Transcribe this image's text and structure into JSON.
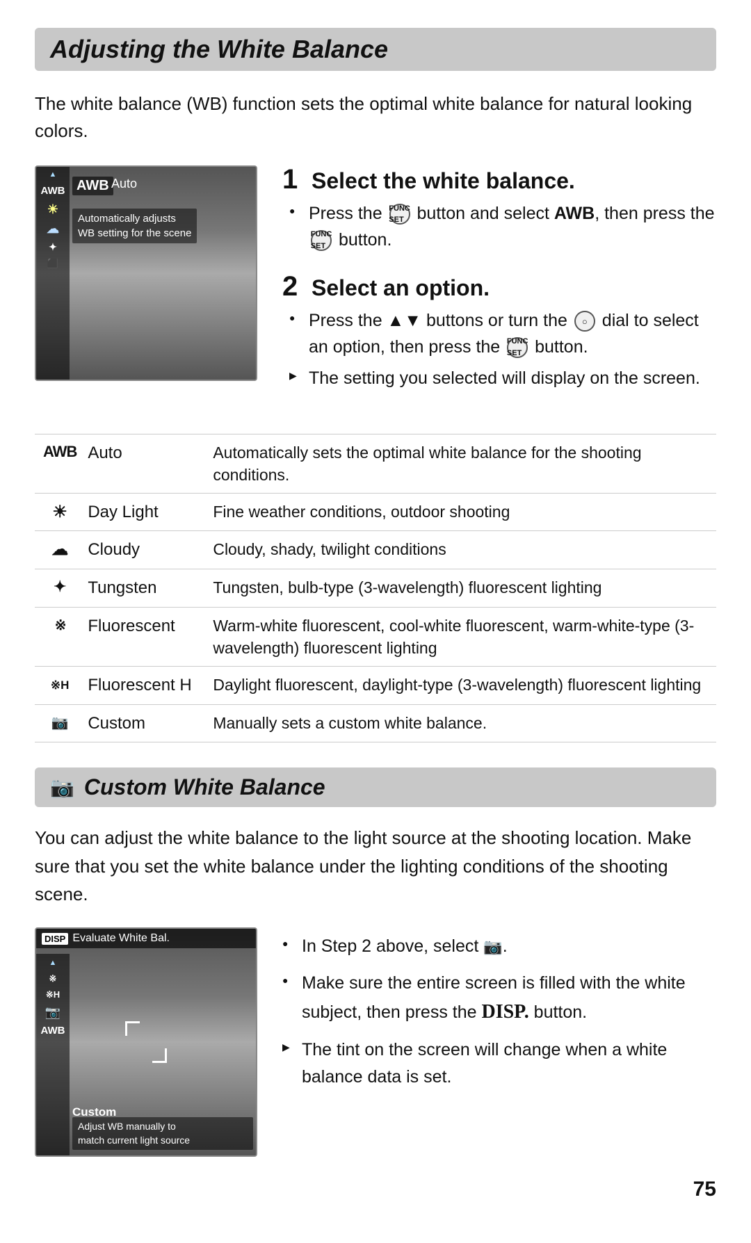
{
  "page": {
    "title": "Adjusting the White Balance",
    "intro": "The white balance (WB) function sets the optimal white balance for natural looking colors.",
    "page_number": "75"
  },
  "step1": {
    "number": "1",
    "title": "Select the white balance.",
    "bullets": [
      {
        "type": "circle",
        "text": "Press the  button and select  , then press the  button."
      }
    ]
  },
  "step2": {
    "number": "2",
    "title": "Select an option.",
    "bullets": [
      {
        "type": "circle",
        "text": "Press the ▲▼ buttons or turn the  dial to select an option, then press the  button."
      },
      {
        "type": "triangle",
        "text": "The setting you selected will display on the screen."
      }
    ]
  },
  "wb_table": {
    "rows": [
      {
        "icon": "AWB",
        "name": "Auto",
        "desc": "Automatically sets the optimal white balance for the shooting conditions."
      },
      {
        "icon": "☀",
        "name": "Day Light",
        "desc": "Fine weather conditions, outdoor shooting"
      },
      {
        "icon": "☁",
        "name": "Cloudy",
        "desc": "Cloudy, shady, twilight conditions"
      },
      {
        "icon": "✦",
        "name": "Tungsten",
        "desc": "Tungsten, bulb-type (3-wavelength) fluorescent lighting"
      },
      {
        "icon": "※",
        "name": "Fluorescent",
        "desc": "Warm-white fluorescent, cool-white fluorescent, warm-white-type (3-wavelength) fluorescent lighting"
      },
      {
        "icon": "※H",
        "name": "Fluorescent H",
        "desc": "Daylight fluorescent, daylight-type (3-wavelength) fluorescent lighting"
      },
      {
        "icon": "⬛",
        "name": "Custom",
        "desc": "Manually sets a custom white balance."
      }
    ]
  },
  "custom_wb": {
    "section_icon": "⬛",
    "title": "Custom White Balance",
    "intro": "You can adjust the white balance to the light source at the shooting location. Make sure that you set the white balance under the lighting conditions of the shooting scene.",
    "bullets": [
      {
        "type": "circle",
        "text": "In Step 2 above, select ."
      },
      {
        "type": "circle",
        "text": "Make sure the entire screen is filled with the white subject, then press the DISP. button."
      },
      {
        "type": "triangle",
        "text": "The tint on the screen will change when a white balance data is set."
      }
    ]
  },
  "camera_screen1": {
    "awb_label": "AWB",
    "auto_label": "Auto",
    "desc_line1": "Automatically adjusts",
    "desc_line2": "WB setting for the scene"
  },
  "camera_screen2": {
    "disp_badge": "DISP",
    "top_label": "Evaluate White Bal.",
    "custom_label": "Custom",
    "desc_line1": "Adjust WB manually to",
    "desc_line2": "match current light source"
  }
}
